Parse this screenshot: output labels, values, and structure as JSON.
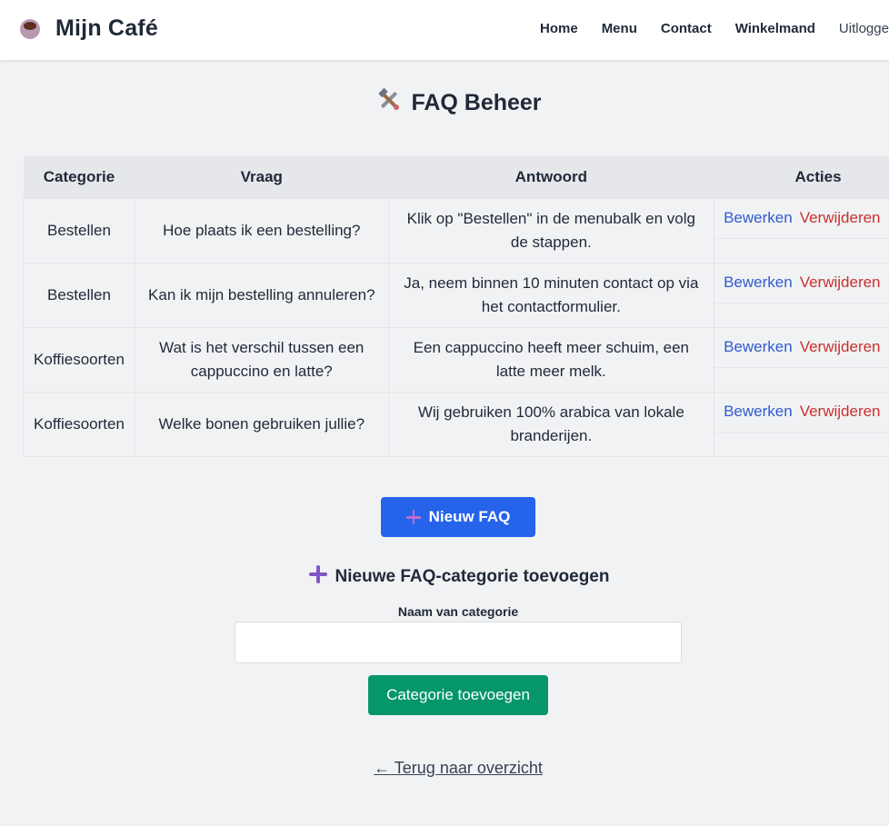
{
  "brand": {
    "name": "Mijn Café",
    "icon": "coffee-cup-icon"
  },
  "nav": {
    "items": [
      "Home",
      "Menu",
      "Contact",
      "Winkelmand"
    ],
    "logout": "Uitloggen"
  },
  "page": {
    "title": "FAQ Beheer",
    "title_icon": "tools-icon"
  },
  "table": {
    "headers": [
      "Categorie",
      "Vraag",
      "Antwoord",
      "Acties"
    ],
    "rows": [
      {
        "categorie": "Bestellen",
        "vraag": "Hoe plaats ik een bestelling?",
        "antwoord": "Klik op \"Bestellen\" in de menubalk en volg de stappen.",
        "edit": "Bewerken",
        "delete": "Verwijderen"
      },
      {
        "categorie": "Bestellen",
        "vraag": "Kan ik mijn bestelling annuleren?",
        "antwoord": "Ja, neem binnen 10 minuten contact op via het contactformulier.",
        "edit": "Bewerken",
        "delete": "Verwijderen"
      },
      {
        "categorie": "Koffiesoorten",
        "vraag": "Wat is het verschil tussen een cappuccino en latte?",
        "antwoord": "Een cappuccino heeft meer schuim, een latte meer melk.",
        "edit": "Bewerken",
        "delete": "Verwijderen"
      },
      {
        "categorie": "Koffiesoorten",
        "vraag": "Welke bonen gebruiken jullie?",
        "antwoord": "Wij gebruiken 100% arabica van lokale branderijen.",
        "edit": "Bewerken",
        "delete": "Verwijderen"
      }
    ]
  },
  "new_faq": {
    "label": "Nieuw FAQ",
    "icon": "plus-icon"
  },
  "category_form": {
    "heading": "Nieuwe FAQ-categorie toevoegen",
    "heading_icon": "plus-icon",
    "field_label": "Naam van categorie",
    "field_value": "",
    "field_placeholder": "",
    "submit_label": "Categorie toevoegen"
  },
  "back_link": "← Terug naar overzicht",
  "colors": {
    "primary": "#2563eb",
    "success": "#059669",
    "danger": "#c9302c",
    "link": "#2f5bd1"
  }
}
